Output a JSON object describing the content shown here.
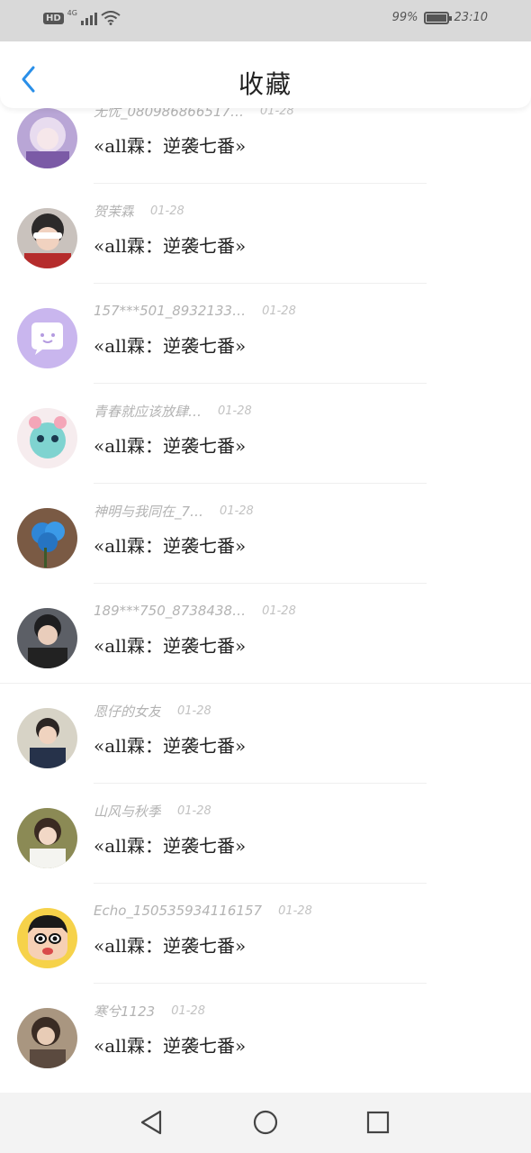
{
  "status_bar": {
    "hd": "HD",
    "network": "4G",
    "battery": "99%",
    "time": "23:10"
  },
  "header": {
    "title": "收藏",
    "back_icon": "chevron-left-icon"
  },
  "items": [
    {
      "name": "无忧_080986866517…",
      "date": "01-28",
      "book": "«all霖：逆袭七番»"
    },
    {
      "name": "贺茉霖",
      "date": "01-28",
      "book": "«all霖：逆袭七番»"
    },
    {
      "name": "157***501_8932133…",
      "date": "01-28",
      "book": "«all霖：逆袭七番»"
    },
    {
      "name": "青春就应该放肆…",
      "date": "01-28",
      "book": "«all霖：逆袭七番»"
    },
    {
      "name": "神明与我同在_7…",
      "date": "01-28",
      "book": "«all霖：逆袭七番»"
    },
    {
      "name": "189***750_8738438…",
      "date": "01-28",
      "book": "«all霖：逆袭七番»"
    },
    {
      "name": "恩仔的女友",
      "date": "01-28",
      "book": "«all霖：逆袭七番»"
    },
    {
      "name": "山风与秋季",
      "date": "01-28",
      "book": "«all霖：逆袭七番»"
    },
    {
      "name": "Echo_150535934116157",
      "date": "01-28",
      "book": "«all霖：逆袭七番»"
    },
    {
      "name": "寒兮1123",
      "date": "01-28",
      "book": "«all霖：逆袭七番»"
    }
  ],
  "nav_bar": {
    "back_icon": "triangle-back-icon",
    "home_icon": "circle-home-icon",
    "recents_icon": "square-recents-icon"
  },
  "colors": {
    "accent": "#2a8fe8",
    "status_bar_bg": "#d9d9d9",
    "nav_bar_bg": "#f3f3f3"
  }
}
